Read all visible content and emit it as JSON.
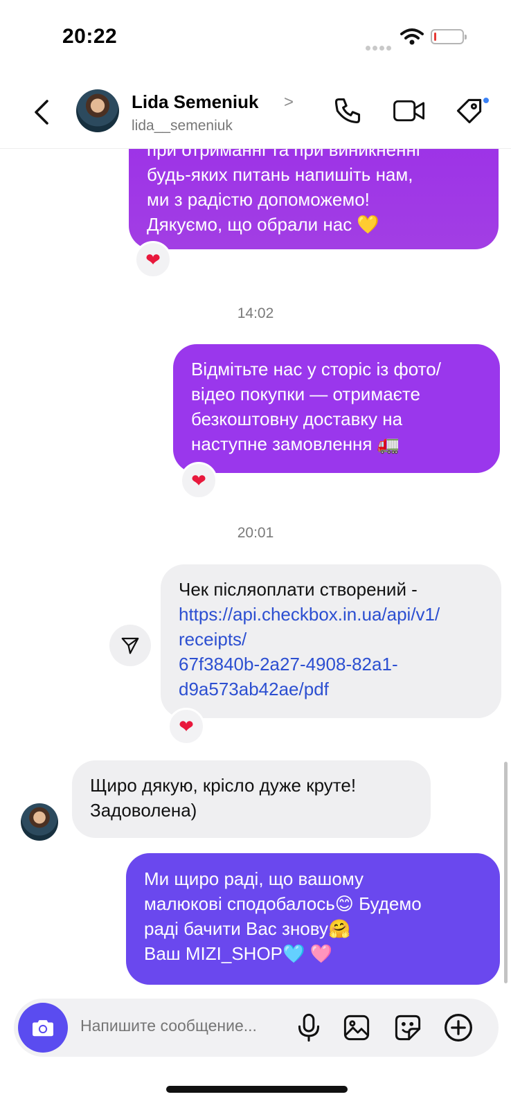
{
  "status_bar": {
    "time": "20:22",
    "battery_level": 0.08,
    "battery_color": "#e53935"
  },
  "header": {
    "name": "Lida Semeniuk",
    "username": "lida__semeniuk",
    "icons": [
      "chevron-left-icon",
      "phone-icon",
      "video-icon",
      "tag-icon"
    ]
  },
  "messages": {
    "m1": {
      "lines": [
        "при отриманні та при виникненні",
        "будь-яких питань напишіть нам,",
        "ми з радістю допоможемо!",
        "Дякуємо, що обрали нас 💛"
      ],
      "reaction": "❤"
    },
    "ts1": "14:02",
    "m2": {
      "lines": [
        "Відмітьте нас у сторіс із фото/",
        "відео покупки — отримаєте",
        "безкоштовну доставку на",
        "наступне замовлення 🚛"
      ],
      "reaction": "❤"
    },
    "ts2": "20:01",
    "m3": {
      "text": "Чек післяоплати створений -",
      "link_lines": [
        "https://api.checkbox.in.ua/api/v1/",
        "receipts/",
        "67f3840b-2a27-4908-82a1-",
        "d9a573ab42ae/pdf"
      ],
      "reaction": "❤"
    },
    "m4": {
      "lines": [
        "Щиро дякую, крісло дуже круте!",
        "Задоволена)"
      ]
    },
    "m5": {
      "lines": [
        "Ми щиро раді, що вашому",
        "малюкові сподобалось😊  Будемо",
        "раді бачити Вас знову🤗",
        "Ваш MIZI_SHOP🩵 🩷"
      ]
    }
  },
  "composer": {
    "placeholder": "Напишите сообщение..."
  },
  "colors": {
    "outgoing_purple": "#9a37ec",
    "outgoing_indigo": "#6a48ee",
    "incoming_gray": "#efeff1",
    "link_blue": "#2c4fd1",
    "unread_dot": "#3b82f6"
  }
}
